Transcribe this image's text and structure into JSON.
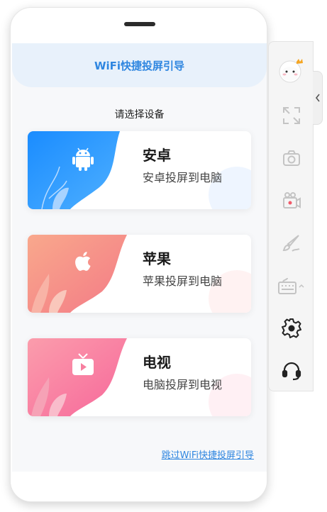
{
  "header": {
    "title": "WiFi快捷投屏引导"
  },
  "subtitle": "请选择设备",
  "cards": [
    {
      "title": "安卓",
      "desc": "安卓投屏到电脑",
      "icon": "android-icon",
      "color_start": "#1a8cff",
      "color_end": "#4fb0ff"
    },
    {
      "title": "苹果",
      "desc": "苹果投屏到电脑",
      "icon": "apple-icon",
      "color_start": "#f9a88c",
      "color_end": "#f37a86"
    },
    {
      "title": "电视",
      "desc": "电脑投屏到电视",
      "icon": "tv-icon",
      "color_start": "#fb9dac",
      "color_end": "#f7679a"
    }
  ],
  "skip_link": "跳过WiFi快捷投屏引导",
  "sidebar": {
    "items": [
      {
        "icon": "avatar-icon"
      },
      {
        "icon": "fullscreen-icon"
      },
      {
        "icon": "camera-icon"
      },
      {
        "icon": "video-record-icon"
      },
      {
        "icon": "brush-icon"
      },
      {
        "icon": "keyboard-icon"
      },
      {
        "icon": "settings-icon"
      },
      {
        "icon": "headset-icon"
      }
    ],
    "collapse_icon": "chevron-left-icon"
  }
}
